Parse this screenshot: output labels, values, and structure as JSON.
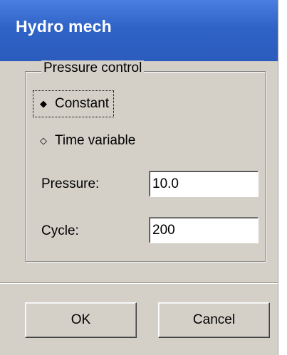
{
  "window": {
    "title": "Hydro mech"
  },
  "pressure_control": {
    "legend": "Pressure control",
    "options": [
      {
        "label": "Constant",
        "selected": true,
        "marker": "◆"
      },
      {
        "label": "Time variable",
        "selected": false,
        "marker": "◇"
      }
    ]
  },
  "fields": {
    "pressure": {
      "label": "Pressure:",
      "value": "10.0"
    },
    "cycle": {
      "label": "Cycle:",
      "value": "200"
    }
  },
  "buttons": {
    "ok_label": "OK",
    "cancel_label": "Cancel"
  },
  "colors": {
    "titlebar": "#2f63c6",
    "dialog_bg": "#d4d0c8"
  }
}
